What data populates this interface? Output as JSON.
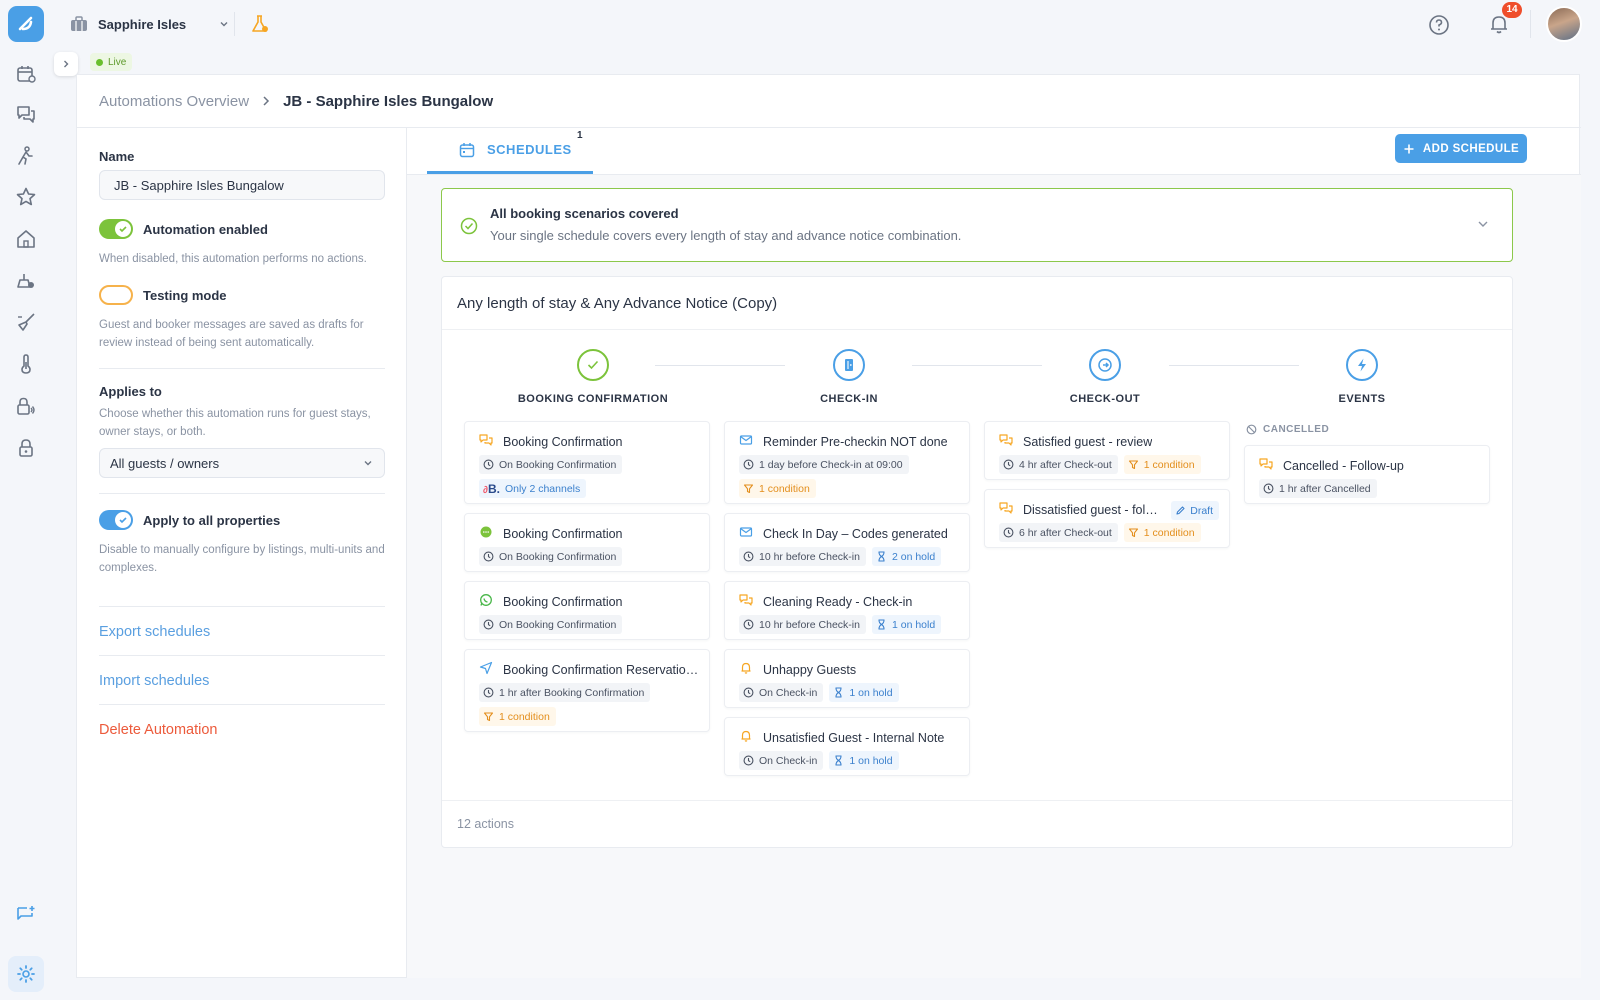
{
  "topbar": {
    "property_name": "Sapphire Isles",
    "notification_count": "14"
  },
  "live_badge": "Live",
  "breadcrumb": {
    "parent": "Automations Overview",
    "current": "JB - Sapphire Isles Bungalow"
  },
  "settings": {
    "name_label": "Name",
    "name_value": "JB - Sapphire Isles Bungalow",
    "automation_enabled_label": "Automation enabled",
    "automation_enabled_help": "When disabled, this automation performs no actions.",
    "testing_mode_label": "Testing mode",
    "testing_mode_help": "Guest and booker messages are saved as drafts for review instead of being sent automatically.",
    "applies_to_label": "Applies to",
    "applies_to_help": "Choose whether this automation runs for guest stays, owner stays, or both.",
    "applies_to_value": "All guests / owners",
    "apply_all_label": "Apply to all properties",
    "apply_all_help": "Disable to manually configure by listings, multi-units and complexes.",
    "export_link": "Export schedules",
    "import_link": "Import schedules",
    "delete_link": "Delete Automation"
  },
  "tabs": {
    "schedules_label": "SCHEDULES",
    "schedules_count": "1",
    "add_schedule_label": "ADD SCHEDULE"
  },
  "coverage": {
    "title": "All booking scenarios covered",
    "subtitle": "Your single schedule covers every length of stay and advance notice combination."
  },
  "schedule": {
    "title": "Any length of stay & Any Advance Notice (Copy)",
    "stages": [
      "BOOKING CONFIRMATION",
      "CHECK-IN",
      "CHECK-OUT",
      "EVENTS"
    ],
    "cancelled_label": "CANCELLED",
    "actions_count": "12 actions",
    "booking": [
      {
        "title": "Booking Confirmation",
        "timing": "On Booking Confirmation",
        "extra": "Only 2 channels",
        "icon": "chat-bubbles-icon"
      },
      {
        "title": "Booking Confirmation",
        "timing": "On Booking Confirmation",
        "icon": "sms-icon"
      },
      {
        "title": "Booking Confirmation",
        "timing": "On Booking Confirmation",
        "icon": "whatsapp-icon"
      },
      {
        "title": "Booking Confirmation Reservation ...",
        "timing": "1 hr after Booking Confirmation",
        "extra": "1 condition",
        "icon": "send-icon"
      }
    ],
    "checkin": [
      {
        "title": "Reminder Pre-checkin NOT done",
        "timing": "1 day before Check-in at 09:00",
        "extra": "1 condition",
        "icon": "email-icon"
      },
      {
        "title": "Check In Day – Codes generated",
        "timing": "10 hr before Check-in",
        "extra": "2 on hold",
        "icon": "email-icon"
      },
      {
        "title": "Cleaning Ready - Check-in",
        "timing": "10 hr before Check-in",
        "extra": "1 on hold",
        "icon": "chat-bubbles-icon"
      },
      {
        "title": "Unhappy Guests",
        "timing": "On Check-in",
        "extra": "1 on hold",
        "icon": "bell-icon"
      },
      {
        "title": "Unsatisfied Guest - Internal Note",
        "timing": "On Check-in",
        "extra": "1 on hold",
        "icon": "bell-icon"
      }
    ],
    "checkout": [
      {
        "title": "Satisfied guest - review",
        "timing": "4 hr after Check-out",
        "extra": "1 condition",
        "icon": "chat-bubbles-icon"
      },
      {
        "title": "Dissatisfied guest - follo...",
        "timing": "6 hr after Check-out",
        "extra": "1 condition",
        "draft": "Draft",
        "icon": "chat-bubbles-icon"
      }
    ],
    "events": [
      {
        "title": "Cancelled - Follow-up",
        "timing": "1 hr after Cancelled",
        "icon": "chat-bubbles-icon"
      }
    ]
  },
  "colors": {
    "accent": "#4a9fe6",
    "success": "#7cc33b",
    "warning": "#f6b24b",
    "danger": "#ec5a3b"
  }
}
